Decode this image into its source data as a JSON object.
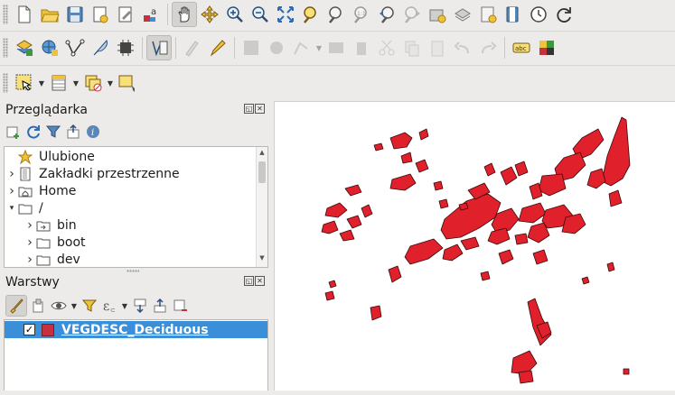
{
  "toolbars": {
    "file_tools": [
      "new-project-icon",
      "open-project-icon",
      "save-project-icon",
      "new-print-layout-icon",
      "style-manager-icon",
      "text-annotation-icon"
    ],
    "nav_tools": [
      "pan-icon",
      "pan-to-selection-icon",
      "zoom-in-icon",
      "zoom-out-icon",
      "zoom-full-icon",
      "zoom-to-selection-icon",
      "zoom-to-layer-icon",
      "zoom-native-icon",
      "zoom-last-icon",
      "zoom-next-icon",
      "new-bookmark-icon",
      "show-bookmarks-icon",
      "new-map-view-icon",
      "temporal-controller-icon",
      "refresh-icon"
    ]
  },
  "browser_panel": {
    "title": "Przeglądarka",
    "items": [
      {
        "label": "Ulubione",
        "icon": "star-icon",
        "expandable": false,
        "indent": 0
      },
      {
        "label": "Zakładki przestrzenne",
        "icon": "bookmarks-icon",
        "expandable": true,
        "indent": 0
      },
      {
        "label": "Home",
        "icon": "home-folder-icon",
        "expandable": true,
        "indent": 0
      },
      {
        "label": "/",
        "icon": "folder-icon",
        "expandable": true,
        "expanded": true,
        "indent": 0
      },
      {
        "label": "bin",
        "icon": "folder-link-icon",
        "expandable": true,
        "indent": 1
      },
      {
        "label": "boot",
        "icon": "folder-icon",
        "expandable": true,
        "indent": 1
      },
      {
        "label": "dev",
        "icon": "folder-icon",
        "expandable": true,
        "indent": 1
      }
    ]
  },
  "layers_panel": {
    "title": "Warstwy",
    "layers": [
      {
        "name": "VEGDESC_Deciduous",
        "visible": true,
        "symbol_color": "#c6303f",
        "selected": true
      }
    ]
  },
  "colors": {
    "polygon_fill": "#e0202a",
    "polygon_stroke": "#3a0a0c",
    "selection_blue": "#3b8ed8",
    "chrome": "#ecebe9"
  }
}
